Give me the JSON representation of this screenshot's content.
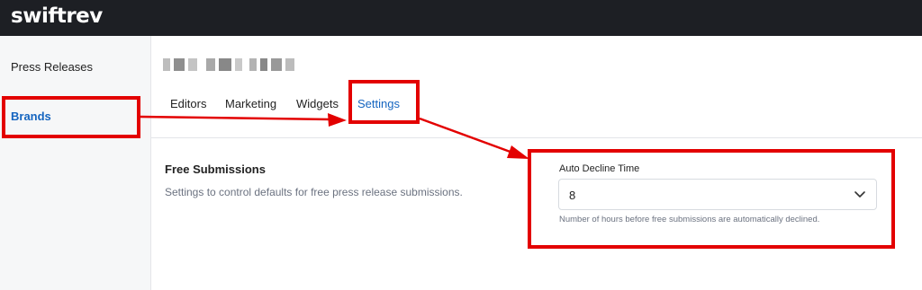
{
  "app": {
    "logo": "swiftrev"
  },
  "sidebar": {
    "items": [
      {
        "label": "Press Releases"
      },
      {
        "label": "Brands"
      }
    ]
  },
  "tabs": [
    {
      "label": "Editors"
    },
    {
      "label": "Marketing"
    },
    {
      "label": "Widgets"
    },
    {
      "label": "Settings"
    }
  ],
  "settings": {
    "section_title": "Free Submissions",
    "section_description": "Settings to control defaults for free press release submissions.",
    "auto_decline": {
      "label": "Auto Decline Time",
      "value": "8",
      "helper": "Number of hours before free submissions are automatically declined."
    }
  },
  "annotation": {
    "color": "#e30000"
  },
  "colors": {
    "topbar": "#1d1f24",
    "accent": "#1565c0",
    "sidebar": "#f6f7f8"
  }
}
